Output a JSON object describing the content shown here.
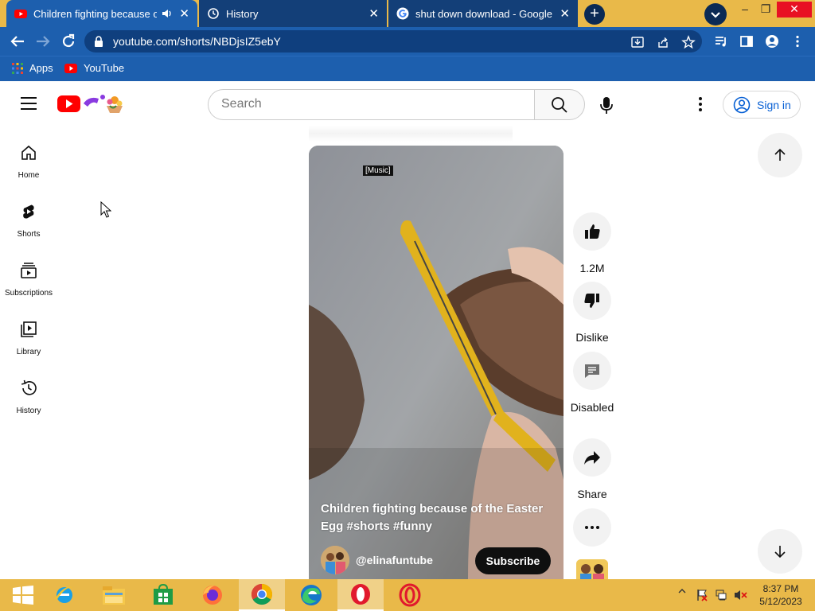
{
  "browser": {
    "tabs": [
      {
        "title": "Children fighting because of",
        "active": true,
        "audio_icon": "speaker-icon"
      },
      {
        "title": "History",
        "active": false
      },
      {
        "title": "shut down download - Google S",
        "active": false
      }
    ],
    "window_controls": {
      "minimize": "–",
      "restore": "❐",
      "close": "✕"
    },
    "url": "youtube.com/shorts/NBDjsIZ5ebY",
    "bookmarks": [
      {
        "label": "Apps",
        "icon": "apps-grid-icon"
      },
      {
        "label": "YouTube",
        "icon": "youtube-icon"
      }
    ]
  },
  "youtube": {
    "search_placeholder": "Search",
    "sign_in_label": "Sign in",
    "sidenav": [
      {
        "label": "Home",
        "icon": "home-icon"
      },
      {
        "label": "Shorts",
        "icon": "shorts-icon"
      },
      {
        "label": "Subscriptions",
        "icon": "subscriptions-icon"
      },
      {
        "label": "Library",
        "icon": "library-icon"
      },
      {
        "label": "History",
        "icon": "history-icon"
      }
    ]
  },
  "short": {
    "music_tag": "[Music]",
    "title": "Children fighting because of the Easter Egg #shorts #funny",
    "channel": "@elinafuntube",
    "subscribe_label": "Subscribe",
    "actions": {
      "like_count": "1.2M",
      "dislike_label": "Dislike",
      "comments_label": "Disabled",
      "share_label": "Share"
    }
  },
  "taskbar": {
    "apps": [
      "windows-start-icon",
      "internet-explorer-icon",
      "file-explorer-icon",
      "store-icon",
      "firefox-icon",
      "chrome-icon",
      "edge-icon",
      "opera-icon",
      "opera-gx-icon"
    ],
    "clock_time": "8:37 PM",
    "clock_date": "5/12/2023"
  },
  "colors": {
    "chrome_frame": "#e9b949",
    "chrome_toolbar": "#1d5fae",
    "youtube_red": "#ff0000",
    "link_blue": "#065fd4"
  }
}
